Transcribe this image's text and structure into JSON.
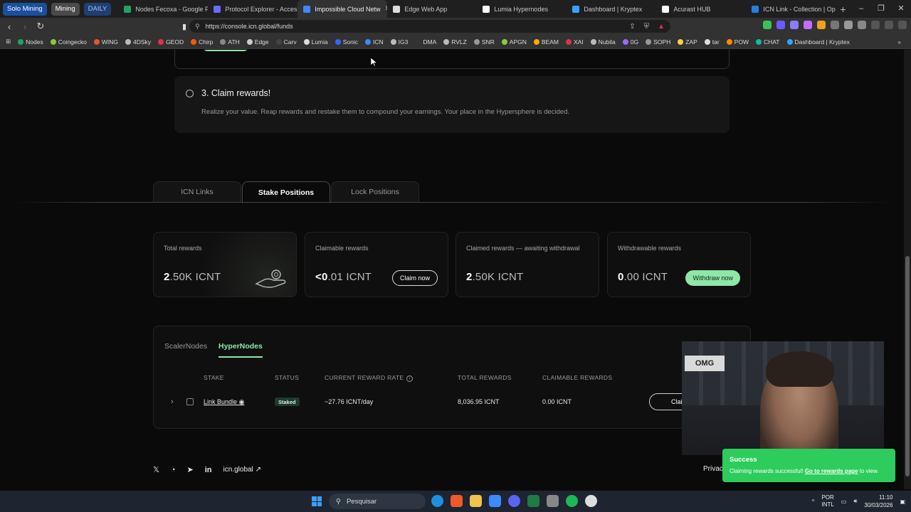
{
  "browser": {
    "tab_groups": [
      "Solo Mining",
      "Mining",
      "DAILY"
    ],
    "tabs": [
      {
        "label": "Nodes Fecoxa - Google Plan",
        "color": "#1fa463"
      },
      {
        "label": "Protocol Explorer - Access R",
        "color": "#6b6bff"
      },
      {
        "label": "Impossible Cloud Netw",
        "color": "#3a8bff",
        "active": true
      },
      {
        "label": "Edge Web App",
        "color": "#dddddd"
      },
      {
        "label": "Lumia Hypernodes",
        "color": "#ffffff"
      },
      {
        "label": "Dashboard | Kryptex",
        "color": "#3aa0ff"
      },
      {
        "label": "Acurast HUB",
        "color": "#ffffff"
      },
      {
        "label": "ICN Link - Collection | Opens",
        "color": "#2081e2"
      }
    ],
    "url": "https://console.icn.global/funds",
    "bookmarks": [
      {
        "label": "Nodes",
        "color": "#1fa463"
      },
      {
        "label": "Coingecko",
        "color": "#8dc63f"
      },
      {
        "label": "WING",
        "color": "#e4572e"
      },
      {
        "label": "4DSky",
        "color": "#bbbbbb"
      },
      {
        "label": "GEOD",
        "color": "#e0314b"
      },
      {
        "label": "Chirp",
        "color": "#f25c05"
      },
      {
        "label": "ATH",
        "color": "#888888"
      },
      {
        "label": "Edge",
        "color": "#cccccc"
      },
      {
        "label": "Carv",
        "color": "#444444"
      },
      {
        "label": "Lumia",
        "color": "#dddddd"
      },
      {
        "label": "Sonic",
        "color": "#3366ff"
      },
      {
        "label": "ICN",
        "color": "#3a8bff"
      },
      {
        "label": "IG3",
        "color": "#bbbbbb"
      },
      {
        "label": "DMA",
        "color": "#333333"
      },
      {
        "label": "RVLZ",
        "color": "#bbbbbb"
      },
      {
        "label": "SNR",
        "color": "#999999"
      },
      {
        "label": "APGN",
        "color": "#88cc44"
      },
      {
        "label": "BEAM",
        "color": "#ffaa00"
      },
      {
        "label": "XAI",
        "color": "#e0314b"
      },
      {
        "label": "Nubila",
        "color": "#bbbbbb"
      },
      {
        "label": "0G",
        "color": "#9a6bff"
      },
      {
        "label": "SOPH",
        "color": "#999999"
      },
      {
        "label": "ZAP",
        "color": "#ffd23f"
      },
      {
        "label": "tar",
        "color": "#dddddd"
      },
      {
        "label": "POW",
        "color": "#ff8a00"
      },
      {
        "label": "CHAT",
        "color": "#14b8a6"
      },
      {
        "label": "Dashboard | Kryptex",
        "color": "#3aa0ff"
      }
    ]
  },
  "steps": {
    "step3_title": "3. Claim rewards!",
    "step3_desc": "Realize your value. Reap rewards and restake them to compound your earnings. Your place in the Hypersphere is decided."
  },
  "page_tabs": [
    "ICN Links",
    "Stake Positions",
    "Lock Positions"
  ],
  "rewards": {
    "total": {
      "label": "Total rewards",
      "lead": "2",
      "rest": ".50K ICNT"
    },
    "claimable": {
      "label": "Claimable rewards",
      "lead": "<0",
      "rest": ".01 ICNT",
      "button": "Claim now"
    },
    "claimed": {
      "label": "Claimed rewards — awaiting withdrawal",
      "lead": "2",
      "rest": ".50K ICNT"
    },
    "withdrawable": {
      "label": "Withdrawable rewards",
      "lead": "0",
      "rest": ".00 ICNT",
      "button": "Withdraw now"
    }
  },
  "nodes": {
    "tabs": [
      "ScalerNodes",
      "HyperNodes"
    ],
    "columns": [
      "STAKE",
      "STATUS",
      "CURRENT REWARD RATE",
      "TOTAL REWARDS",
      "CLAIMABLE REWARDS"
    ],
    "row": {
      "stake": "Link Bundle",
      "status": "Staked",
      "rate": "~27.76 ICNT/day",
      "total": "8,036.95 ICNT",
      "claimable": "0.00 ICNT",
      "action": "Clai"
    }
  },
  "footer": {
    "site": "icn.global",
    "privacy": "Privac"
  },
  "webcam": {
    "sign": "OMG"
  },
  "toast": {
    "title": "Success",
    "message": "Claiming rewards successful!",
    "link": "Go to rewards page",
    "suffix": "to view."
  },
  "taskbar": {
    "search": "Pesquisar",
    "lang1": "POR",
    "lang2": "INTL",
    "time": "11:10",
    "date": "30/03/2026"
  },
  "colors": {
    "accent": "#8fe6a8",
    "toast": "#2ecc5c"
  }
}
